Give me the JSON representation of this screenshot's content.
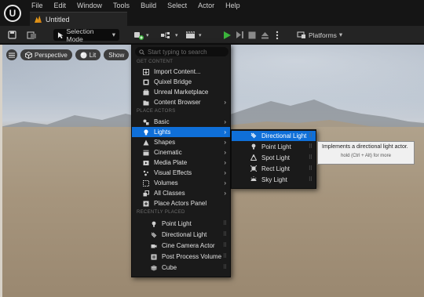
{
  "app": {
    "logo_letter": "U"
  },
  "menubar": {
    "items": [
      "File",
      "Edit",
      "Window",
      "Tools",
      "Build",
      "Select",
      "Actor",
      "Help"
    ]
  },
  "tab": {
    "title": "Untitled"
  },
  "toolbar": {
    "selection_mode": "Selection Mode",
    "platforms": "Platforms"
  },
  "viewport": {
    "perspective": "Perspective",
    "lit": "Lit",
    "show": "Show"
  },
  "dropdown": {
    "search_placeholder": "Start typing to search",
    "section_get_content": "GET CONTENT",
    "get_content": [
      {
        "label": "Import Content...",
        "icon": "import-icon"
      },
      {
        "label": "Quixel Bridge",
        "icon": "bridge-icon"
      },
      {
        "label": "Unreal Marketplace",
        "icon": "marketplace-icon"
      },
      {
        "label": "Content Browser",
        "icon": "content-browser-icon"
      }
    ],
    "section_place_actors": "PLACE ACTORS",
    "place_actors": [
      {
        "label": "Basic",
        "icon": "basic-icon"
      },
      {
        "label": "Lights",
        "icon": "lightbulb-icon"
      },
      {
        "label": "Shapes",
        "icon": "shapes-icon"
      },
      {
        "label": "Cinematic",
        "icon": "cinematic-icon"
      },
      {
        "label": "Media Plate",
        "icon": "media-plate-icon"
      },
      {
        "label": "Visual Effects",
        "icon": "visual-effects-icon"
      },
      {
        "label": "Volumes",
        "icon": "volumes-icon"
      },
      {
        "label": "All Classes",
        "icon": "all-classes-icon"
      },
      {
        "label": "Place Actors Panel",
        "icon": "place-actors-icon"
      }
    ],
    "section_recently_placed": "RECENTLY PLACED",
    "recently_placed": [
      {
        "label": "Point Light",
        "icon": "point-light-icon"
      },
      {
        "label": "Directional Light",
        "icon": "directional-light-icon"
      },
      {
        "label": "Cine Camera Actor",
        "icon": "camera-icon"
      },
      {
        "label": "Post Process Volume",
        "icon": "post-process-icon"
      },
      {
        "label": "Cube",
        "icon": "cube-icon"
      }
    ]
  },
  "lights_submenu": {
    "items": [
      {
        "label": "Directional Light",
        "icon": "directional-light-icon"
      },
      {
        "label": "Point Light",
        "icon": "point-light-icon"
      },
      {
        "label": "Spot Light",
        "icon": "spot-light-icon"
      },
      {
        "label": "Rect Light",
        "icon": "rect-light-icon"
      },
      {
        "label": "Sky Light",
        "icon": "sky-light-icon"
      }
    ]
  },
  "tooltip": {
    "main": "Implements a directional light actor.",
    "hint": "hold (Ctrl + Alt) for more"
  },
  "colors": {
    "accent": "#0f6fd8",
    "play_green": "#3bb33b",
    "menu_bg": "#1a1a1a"
  }
}
